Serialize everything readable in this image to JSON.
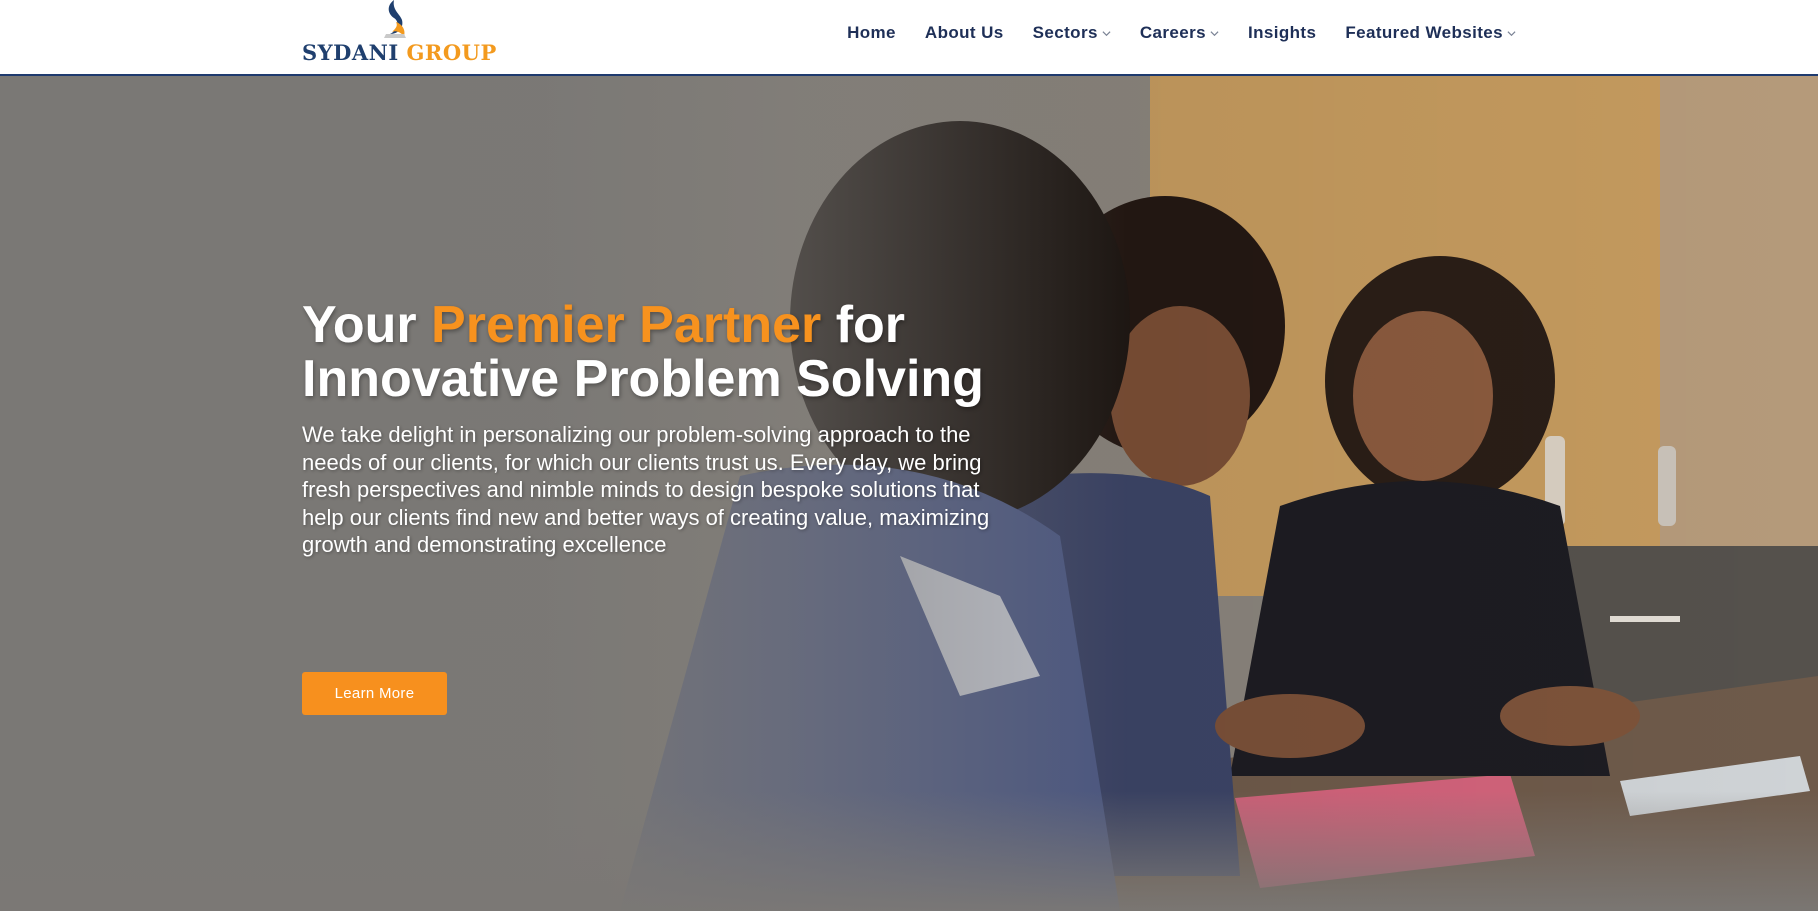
{
  "brand": {
    "name_part1": "SYDANI",
    "name_part2": "GROUP"
  },
  "nav": {
    "items": [
      {
        "label": "Home",
        "has_dropdown": false
      },
      {
        "label": "About Us",
        "has_dropdown": false
      },
      {
        "label": "Sectors",
        "has_dropdown": true
      },
      {
        "label": "Careers",
        "has_dropdown": true
      },
      {
        "label": "Insights",
        "has_dropdown": false
      },
      {
        "label": "Featured Websites",
        "has_dropdown": true
      }
    ]
  },
  "hero": {
    "title_part1": "Your ",
    "title_accent": "Premier Partner",
    "title_part2": " for",
    "title_line2": "Innovative Problem Solving",
    "description": "We take delight in personalizing our problem-solving approach to the needs of our clients, for which our clients trust us. Every day, we bring fresh perspectives and nimble minds to design bespoke solutions that help our clients find new and better ways of creating value, maximizing growth and demonstrating excellence",
    "cta_label": "Learn More"
  },
  "colors": {
    "accent": "#f7921e",
    "navy": "#1e2f57",
    "hero_overlay": "#7a7875"
  },
  "icons": {
    "dropdown": "chevron-down-icon",
    "logo_mark": "flame-swoosh-icon"
  }
}
